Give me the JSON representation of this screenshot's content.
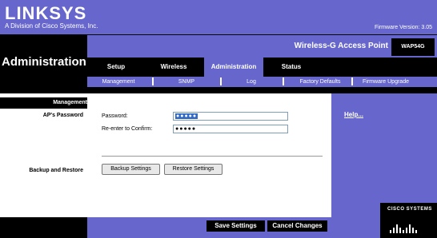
{
  "header": {
    "logo": "LINKSYS",
    "tagline": "A Division of Cisco Systems, Inc.",
    "firmware": "Firmware Version: 3.05",
    "page_title": "Administration",
    "product_name": "Wireless-G Access Point",
    "model": "WAP54G"
  },
  "tabs": [
    {
      "label": "Setup",
      "active": false
    },
    {
      "label": "Wireless",
      "active": false
    },
    {
      "label": "Administration",
      "active": true
    },
    {
      "label": "Status",
      "active": false
    }
  ],
  "subnav": [
    "Management",
    "SNMP",
    "Log",
    "Factory Defaults",
    "Firmware Upgrade"
  ],
  "sidebar": {
    "section": "Management",
    "ap_password": "AP's Password",
    "backup_restore": "Backup and Restore"
  },
  "form": {
    "password_label": "Password:",
    "password_value": "●●●●●",
    "confirm_label": "Re-enter to Confirm:",
    "confirm_value": "●●●●●",
    "backup_button": "Backup Settings",
    "restore_button": "Restore Settings"
  },
  "help": {
    "link": "Help..."
  },
  "footer": {
    "save_button": "Save Settings",
    "cancel_button": "Cancel Changes"
  },
  "brand": {
    "cisco": "CISCO SYSTEMS"
  },
  "colors": {
    "accent": "#6666cc",
    "dark": "#000000",
    "selection": "#316ac5"
  }
}
